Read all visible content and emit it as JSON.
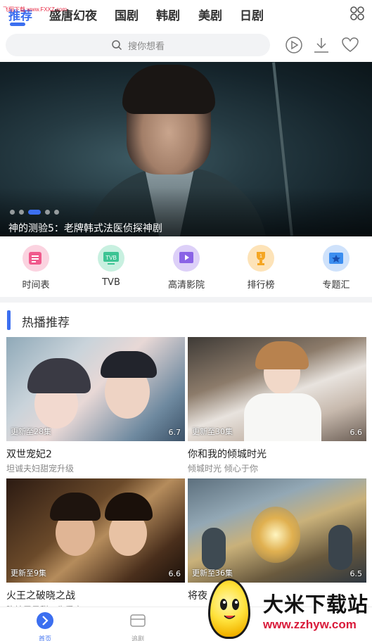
{
  "watermark_top": "飞翔下载 www.FXXZ.com",
  "tabs": [
    {
      "label": "推荐"
    },
    {
      "label": "盛唐幻夜"
    },
    {
      "label": "国剧"
    },
    {
      "label": "韩剧"
    },
    {
      "label": "美剧"
    },
    {
      "label": "日剧"
    }
  ],
  "search": {
    "placeholder": "搜你想看"
  },
  "banner": {
    "caption": "神的测验5：老牌韩式法医侦探神剧",
    "dot_count": 5,
    "active_dot": 2
  },
  "categories": [
    {
      "label": "时间表",
      "icon": "schedule-icon",
      "color": "#f05a8c"
    },
    {
      "label": "TVB",
      "icon": "tvb-icon",
      "color": "#3cc493"
    },
    {
      "label": "高清影院",
      "icon": "cinema-icon",
      "color": "#8a63e6"
    },
    {
      "label": "排行榜",
      "icon": "trophy-icon",
      "color": "#f5a623"
    },
    {
      "label": "专题汇",
      "icon": "topic-icon",
      "color": "#3c8ef0"
    }
  ],
  "section": {
    "title": "热播推荐"
  },
  "cards": [
    {
      "title": "双世宠妃2",
      "subtitle": "坦诚夫妇甜宠升级",
      "episode": "更新至28集",
      "score": "6.7"
    },
    {
      "title": "你和我的倾城时光",
      "subtitle": "倾城时光 倾心于你",
      "episode": "更新至30集",
      "score": "6.6"
    },
    {
      "title": "火王之破晓之战",
      "subtitle": "陈柏霖景甜三生爱恋",
      "episode": "更新至9集",
      "score": "6.6"
    },
    {
      "title": "将夜",
      "subtitle": "",
      "episode": "更新至36集",
      "score": "6.5"
    }
  ],
  "bottom_nav": [
    {
      "label": "首页",
      "icon": "play-home-icon",
      "active": true
    },
    {
      "label": "追剧",
      "icon": "bookmark-screen-icon",
      "active": false
    }
  ],
  "watermark": {
    "brand": "大米下载站",
    "site": "www.zzhyw.com"
  },
  "colors": {
    "accent": "#3c6ff0",
    "divider": "#f2f3f5"
  }
}
